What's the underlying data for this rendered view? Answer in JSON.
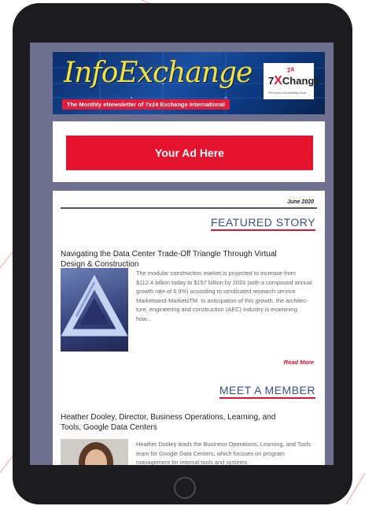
{
  "newsletter": {
    "title": "InfoExchange",
    "tagline": "The Monthly eNewsletter of 7x24 Exchange International",
    "logo_top": "24",
    "logo_main": "Change",
    "logo_x": "X",
    "logo_prefix": "7",
    "logo_sub": "The end-to-end reliability forum"
  },
  "ad": {
    "label": "Your Ad Here"
  },
  "issue": {
    "date": "June 2020"
  },
  "featured": {
    "section_label": "FEATURED STORY",
    "headline": "Navigating the Data Center Trade-Off Triangle Through Virtual Design & Construction",
    "body": "The modular construction market is projected to increase from $112.4 billion today to $157 billion by 2023 (with a compound annual growth rate of 6.9%) according to syndicated research service Marketsand-MarketsTM. In anticipation of this growth, the architec-ture, engineering and construction (AEC) industry is examining how...",
    "read_more": "Read More"
  },
  "member": {
    "section_label": "MEET A MEMBER",
    "headline": "Heather Dooley, Director, Business Operations, Learning, and Tools, Google Data Centers",
    "body": "Heather Dooley leads the Business Operations, Learning, and Tools team for Google Data Centers, which focuses on program management for internal tools and systems"
  },
  "colors": {
    "accent": "#e5132e",
    "section_blue": "#3a4e8c",
    "frame": "#1c1c1f"
  }
}
